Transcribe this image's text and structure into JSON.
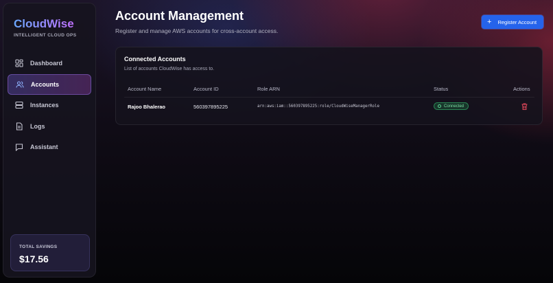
{
  "app": {
    "name": "CloudWise",
    "tagline": "INTELLIGENT CLOUD OPS"
  },
  "sidebar": {
    "items": [
      {
        "label": "Dashboard",
        "icon": "dashboard-icon",
        "active": false
      },
      {
        "label": "Accounts",
        "icon": "users-icon",
        "active": true
      },
      {
        "label": "Instances",
        "icon": "server-icon",
        "active": false
      },
      {
        "label": "Logs",
        "icon": "file-icon",
        "active": false
      },
      {
        "label": "Assistant",
        "icon": "chat-icon",
        "active": false
      }
    ],
    "savings": {
      "label": "TOTAL SAVINGS",
      "value": "$17.56"
    }
  },
  "header": {
    "title": "Account Management",
    "subtitle": "Register and manage AWS accounts for cross-account access.",
    "register_label": "Register Account"
  },
  "panel": {
    "title": "Connected Accounts",
    "subtitle": "List of accounts CloudWise has access to.",
    "columns": [
      "Account Name",
      "Account ID",
      "Role ARN",
      "Status",
      "Actions"
    ],
    "rows": [
      {
        "name": "Rajoo Bhalerao",
        "account_id": "560397895225",
        "role_arn": "arn:aws:iam::560397895225:role/CloudWiseManagerRole",
        "status": "Connected"
      }
    ]
  },
  "colors": {
    "accent": "#2563eb",
    "active_nav": "#6d4fc9",
    "status_green": "#7ee2a5",
    "delete_red": "#e0475a"
  }
}
